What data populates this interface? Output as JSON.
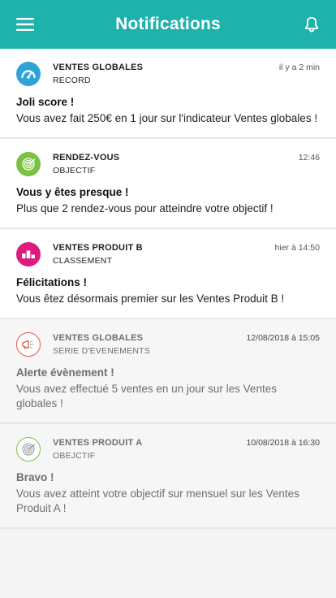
{
  "header": {
    "title": "Notifications",
    "background": "#1fb1ac",
    "menu_icon": "hamburger-icon",
    "bell_icon": "bell-icon"
  },
  "notifications": [
    {
      "category": "VENTES GLOBALES",
      "subcategory": "RECORD",
      "time": "il y a 2 min",
      "headline": "Joli score !",
      "text": "Vous avez fait 250€ en 1 jour sur l'indicateur Ventes globales !",
      "icon": "gauge-icon",
      "color": "#2fa3d8",
      "read": false
    },
    {
      "category": "RENDEZ-VOUS",
      "subcategory": "OBJECTIF",
      "time": "12:46",
      "headline": "Vous y êtes presque !",
      "text": "Plus que 2 rendez-vous pour atteindre votre objectif !",
      "icon": "target-icon",
      "color": "#7cc142",
      "read": false
    },
    {
      "category": "VENTES PRODUIT B",
      "subcategory": "CLASSEMENT",
      "time": "hier à 14:50",
      "headline": "Félicitations !",
      "text": "Vous êtez désormais premier sur les Ventes Produit B !",
      "icon": "podium-icon",
      "color": "#df1a7e",
      "read": false
    },
    {
      "category": "VENTES GLOBALES",
      "subcategory": "SERIE D'EVENEMENTS",
      "time": "12/08/2018 à 15:05",
      "headline": "Alerte évènement !",
      "text": "Vous avez effectué 5 ventes en un jour sur les Ventes globales !",
      "icon": "megaphone-icon",
      "color": "#e05a4e",
      "read": true
    },
    {
      "category": "VENTES PRODUIT A",
      "subcategory": "OBEJCTIF",
      "time": "10/08/2018 à 16:30",
      "headline": "Bravo !",
      "text": "Vous avez atteint votre objectif sur mensuel sur les Ventes Produit A !",
      "icon": "target-icon",
      "color": "#7cc142",
      "read": true
    }
  ]
}
